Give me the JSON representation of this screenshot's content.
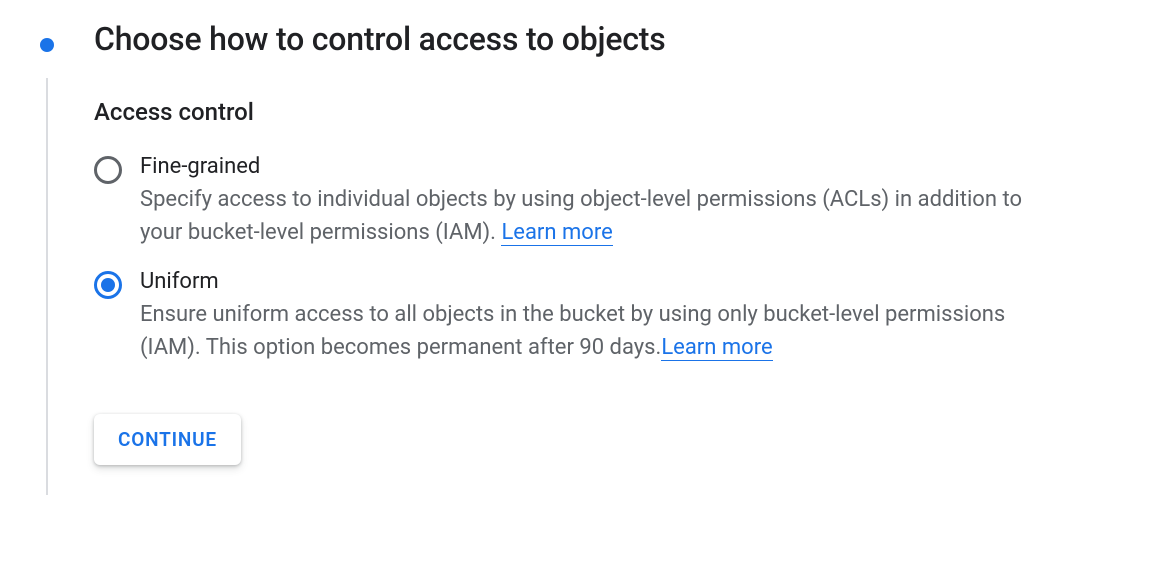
{
  "step": {
    "title": "Choose how to control access to objects"
  },
  "section": {
    "title": "Access control"
  },
  "options": {
    "fine_grained": {
      "label": "Fine-grained",
      "description_before": "Specify access to individual objects by using object-level permissions (ACLs) in addition to your bucket-level permissions (IAM). ",
      "learn_more": "Learn more",
      "selected": false
    },
    "uniform": {
      "label": "Uniform",
      "description_before": "Ensure uniform access to all objects in the bucket by using only bucket-level permissions (IAM). This option becomes permanent after 90 days.",
      "learn_more": "Learn more",
      "selected": true
    }
  },
  "buttons": {
    "continue": "CONTINUE"
  }
}
